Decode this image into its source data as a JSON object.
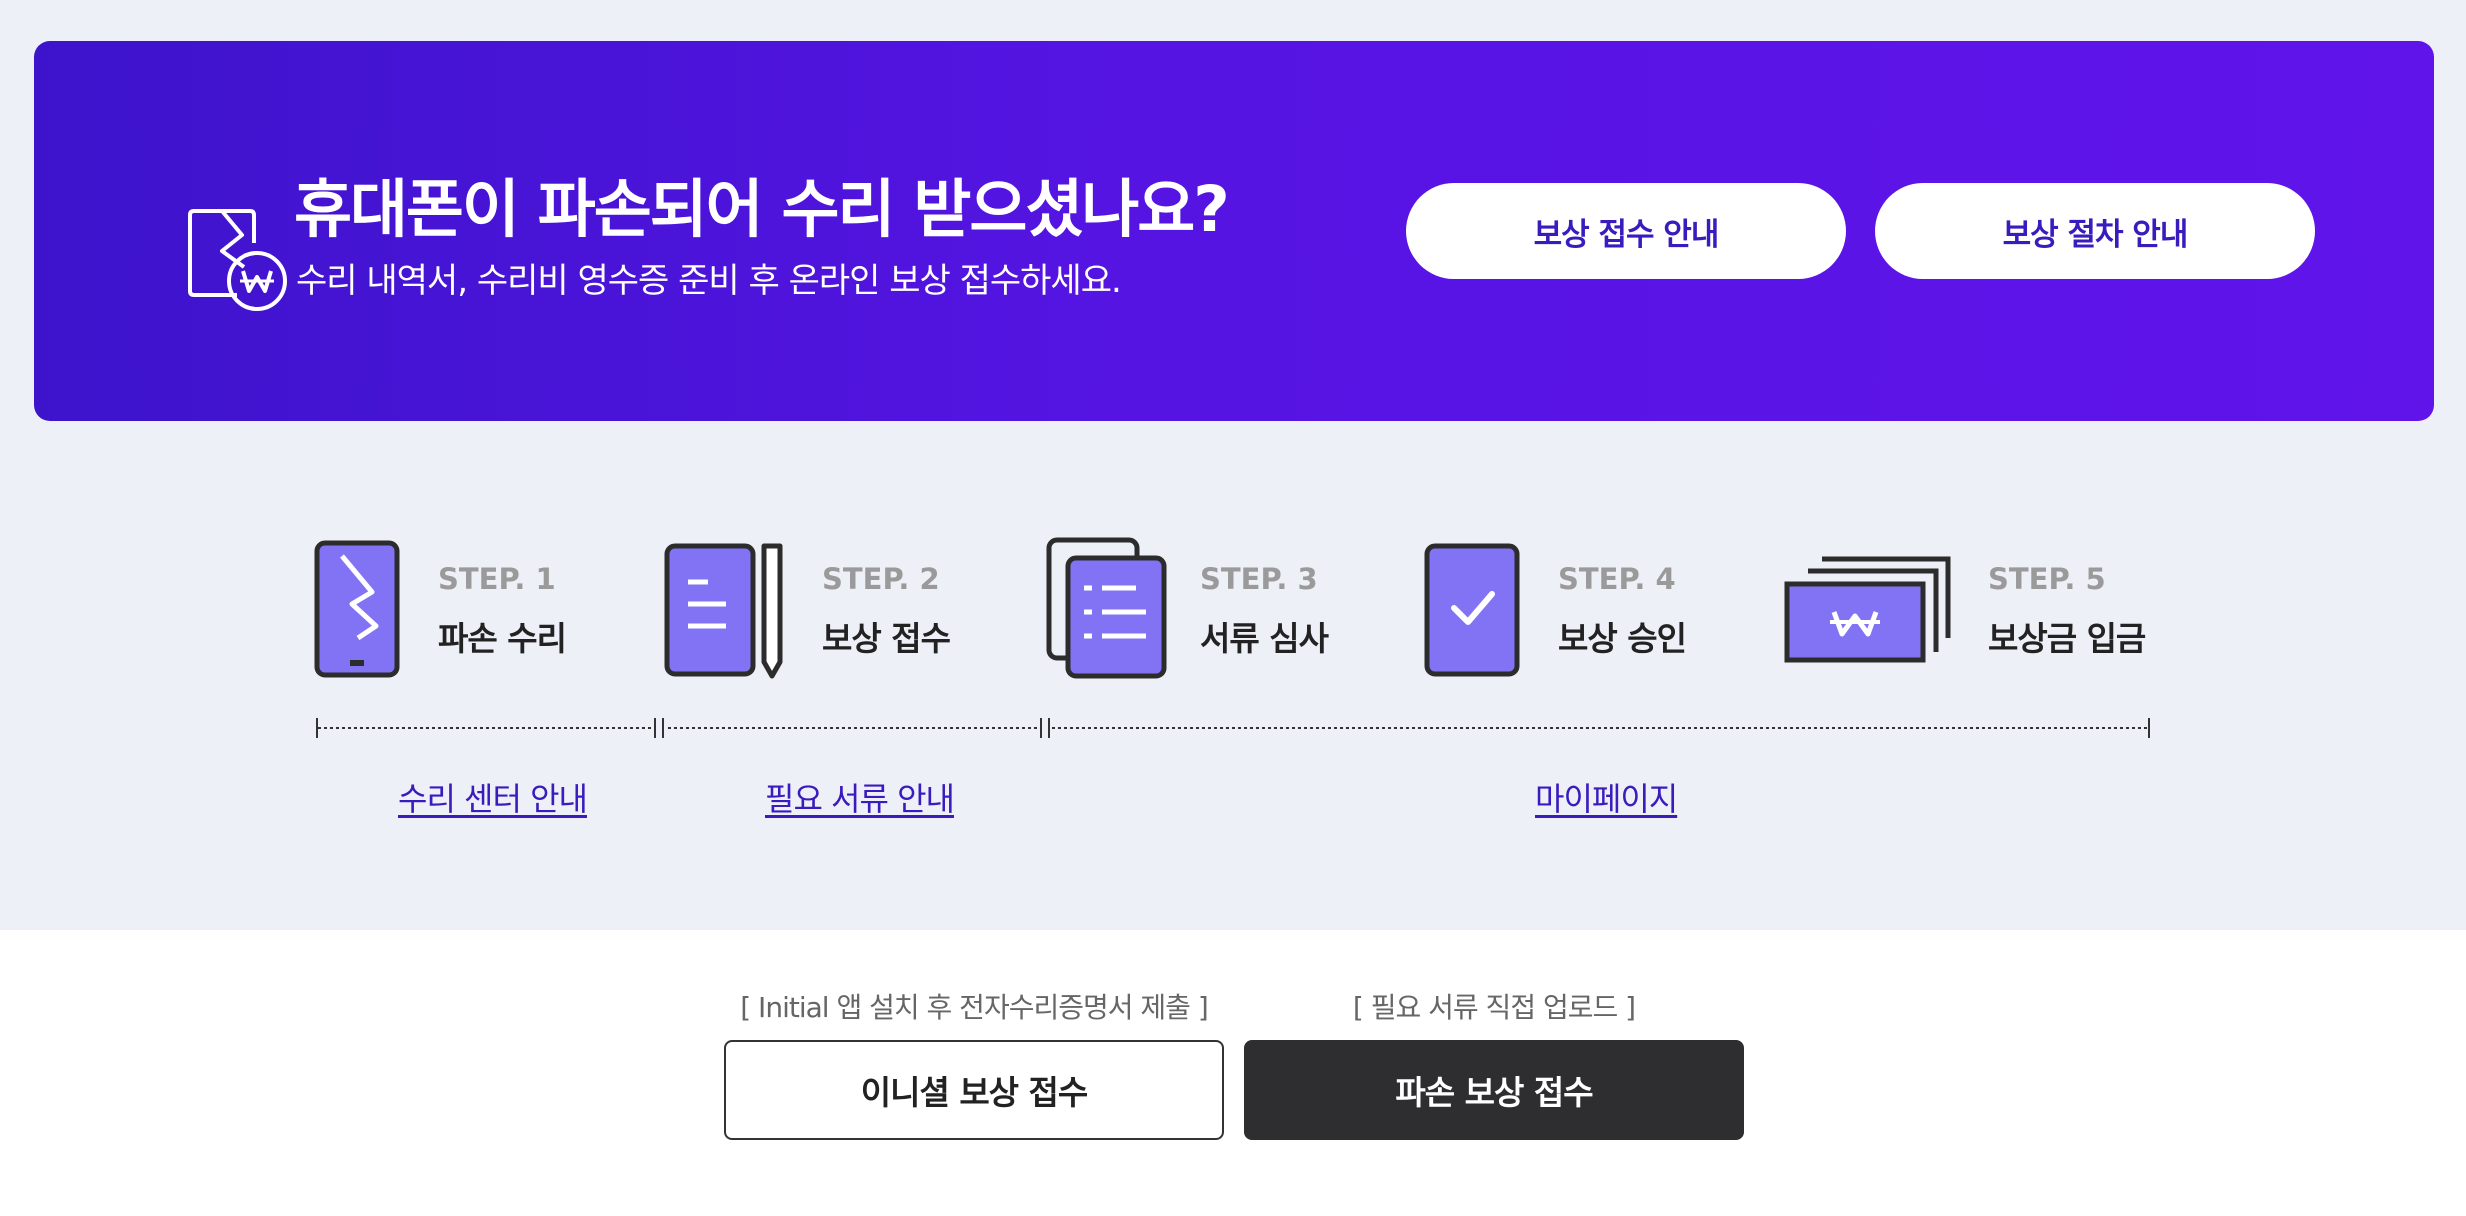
{
  "banner": {
    "icon": "broken-phone-won-icon",
    "title": "휴대폰이 파손되어 수리 받으셨나요?",
    "subtitle": "수리 내역서, 수리비 영수증 준비 후 온라인 보상 접수하세요.",
    "buttons": [
      {
        "label": "보상 접수 안내"
      },
      {
        "label": "보상 절차 안내"
      }
    ]
  },
  "steps": [
    {
      "num": "STEP. 1",
      "label": "파손 수리",
      "icon": "broken-phone-icon"
    },
    {
      "num": "STEP. 2",
      "label": "보상 접수",
      "icon": "document-pen-icon"
    },
    {
      "num": "STEP. 3",
      "label": "서류 심사",
      "icon": "documents-list-icon"
    },
    {
      "num": "STEP. 4",
      "label": "보상 승인",
      "icon": "check-tablet-icon"
    },
    {
      "num": "STEP. 5",
      "label": "보상금 입금",
      "icon": "money-stack-icon"
    }
  ],
  "links": [
    {
      "label": "수리 센터 안내"
    },
    {
      "label": "필요 서류 안내"
    },
    {
      "label": "마이페이지"
    }
  ],
  "actions": [
    {
      "caption": "[ Initial 앱 설치 후 전자수리증명서 제출 ]",
      "label": "이니셜 보상 접수"
    },
    {
      "caption": "[ 필요 서류 직접 업로드 ]",
      "label": "파손 보상 접수"
    }
  ],
  "colors": {
    "accent": "#3a1bbd",
    "banner_start": "#3d14cc",
    "banner_end": "#6014ea",
    "icon_fill": "#8273f5",
    "dark_button": "#2e2e30",
    "page_bg": "#eef0f8"
  }
}
